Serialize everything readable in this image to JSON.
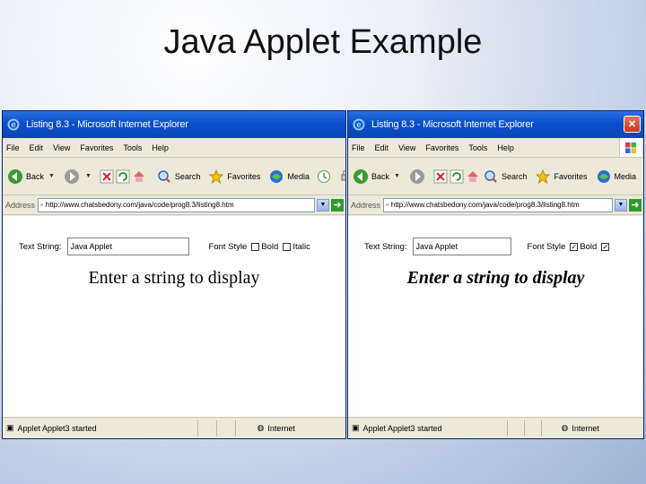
{
  "slide": {
    "title": "Java Applet Example"
  },
  "windows": [
    {
      "title": "Listing 8.3 - Microsoft Internet Explorer",
      "menu": [
        "File",
        "Edit",
        "View",
        "Favorites",
        "Tools",
        "Help"
      ],
      "toolbar": {
        "back": "Back",
        "search": "Search",
        "favorites": "Favorites",
        "media": "Media"
      },
      "address": {
        "label": "Address",
        "url": "http://www.chatsbedony.com/java/code/prog8.3/listing8.htm"
      },
      "applet": {
        "text_label": "Text String:",
        "text_value": "Java Applet",
        "font_label": "Font Style",
        "bold_label": "Bold",
        "italic_label": "Italic",
        "bold_checked": false,
        "italic_checked": false,
        "display": "Enter a string to display"
      },
      "status": {
        "text": "Applet Applet3 started",
        "zone": "Internet"
      }
    },
    {
      "title": "Listing 8.3 - Microsoft Internet Explorer",
      "menu": [
        "File",
        "Edit",
        "View",
        "Favorites",
        "Tools",
        "Help"
      ],
      "toolbar": {
        "back": "Back",
        "search": "Search",
        "favorites": "Favorites",
        "media": "Media"
      },
      "address": {
        "label": "Address",
        "url": "http://www.chatsbedony.com/java/code/prog8.3/listing8.htm"
      },
      "applet": {
        "text_label": "Text String:",
        "text_value": "Java Applet",
        "font_label": "Font Style",
        "bold_label": "Bold",
        "italic_label": "",
        "bold_checked": true,
        "italic_checked": true,
        "display": "Enter a string to display"
      },
      "status": {
        "text": "Applet Applet3 started",
        "zone": "Internet"
      }
    }
  ]
}
